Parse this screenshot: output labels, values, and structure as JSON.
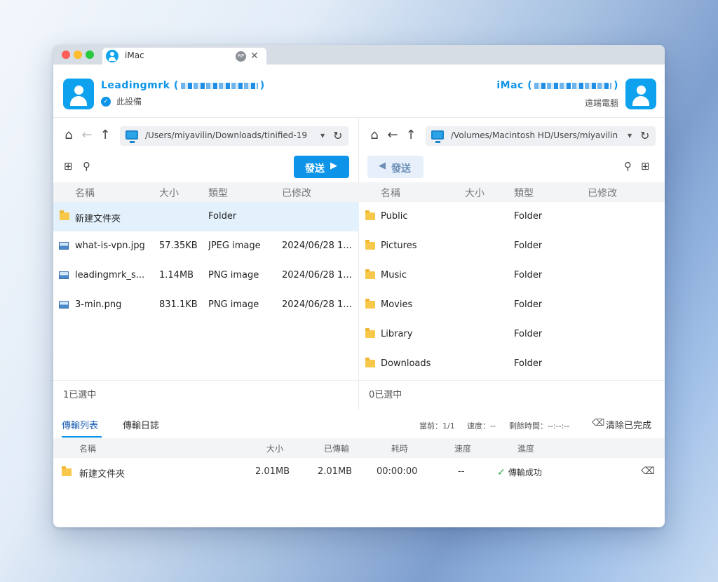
{
  "window": {
    "tab_title": "iMac",
    "tab_badge": "RP",
    "tab_close": "✕"
  },
  "local_device": {
    "name": "Leadingmrk (",
    "name_close": ")",
    "subtitle": "此設備"
  },
  "remote_device": {
    "name": "iMac (",
    "name_close": ")",
    "subtitle": "遠端電腦"
  },
  "left_pane": {
    "path": "/Users/miyavilin/Downloads/tinified-19",
    "send_label": "發送",
    "columns": [
      "名稱",
      "大小",
      "類型",
      "已修改"
    ],
    "files": [
      {
        "name": "新建文件夾",
        "size": "",
        "type": "Folder",
        "modified": "",
        "icon": "folder-icon",
        "selected": true
      },
      {
        "name": "what-is-vpn.jpg",
        "size": "57.35KB",
        "type": "JPEG image",
        "modified": "2024/06/28 1...",
        "icon": "image-icon"
      },
      {
        "name": "leadingmrk_s...",
        "size": "1.14MB",
        "type": "PNG image",
        "modified": "2024/06/28 1...",
        "icon": "image-icon"
      },
      {
        "name": "3-min.png",
        "size": "831.1KB",
        "type": "PNG image",
        "modified": "2024/06/28 1...",
        "icon": "image-icon"
      }
    ],
    "status": "1已選中"
  },
  "right_pane": {
    "path": "/Volumes/Macintosh HD/Users/miyavilin",
    "send_label": "發送",
    "columns": [
      "名稱",
      "大小",
      "類型",
      "已修改"
    ],
    "files": [
      {
        "name": "Public",
        "type": "Folder",
        "icon": "folder-icon"
      },
      {
        "name": "Pictures",
        "type": "Folder",
        "icon": "folder-icon"
      },
      {
        "name": "Music",
        "type": "Folder",
        "icon": "folder-icon"
      },
      {
        "name": "Movies",
        "type": "Folder",
        "icon": "folder-icon"
      },
      {
        "name": "Library",
        "type": "Folder",
        "icon": "folder-icon"
      },
      {
        "name": "Downloads",
        "type": "Folder",
        "icon": "folder-icon"
      }
    ],
    "status": "0已選中"
  },
  "transfer": {
    "tabs": [
      "傳輸列表",
      "傳輸日誌"
    ],
    "current": "當前：1/1",
    "speed": "速度：--",
    "remaining": "剩餘時間：--:--:--",
    "clear_label": "清除已完成",
    "columns": [
      "名稱",
      "大小",
      "已傳輸",
      "耗時",
      "速度",
      "進度"
    ],
    "rows": [
      {
        "name": "新建文件夾",
        "size": "2.01MB",
        "transferred": "2.01MB",
        "elapsed": "00:00:00",
        "speed": "--",
        "progress": "傳輸成功"
      }
    ]
  },
  "colors": {
    "accent": "#0d94e8",
    "selected_row": "#e3f1fc",
    "success": "#29a745"
  }
}
